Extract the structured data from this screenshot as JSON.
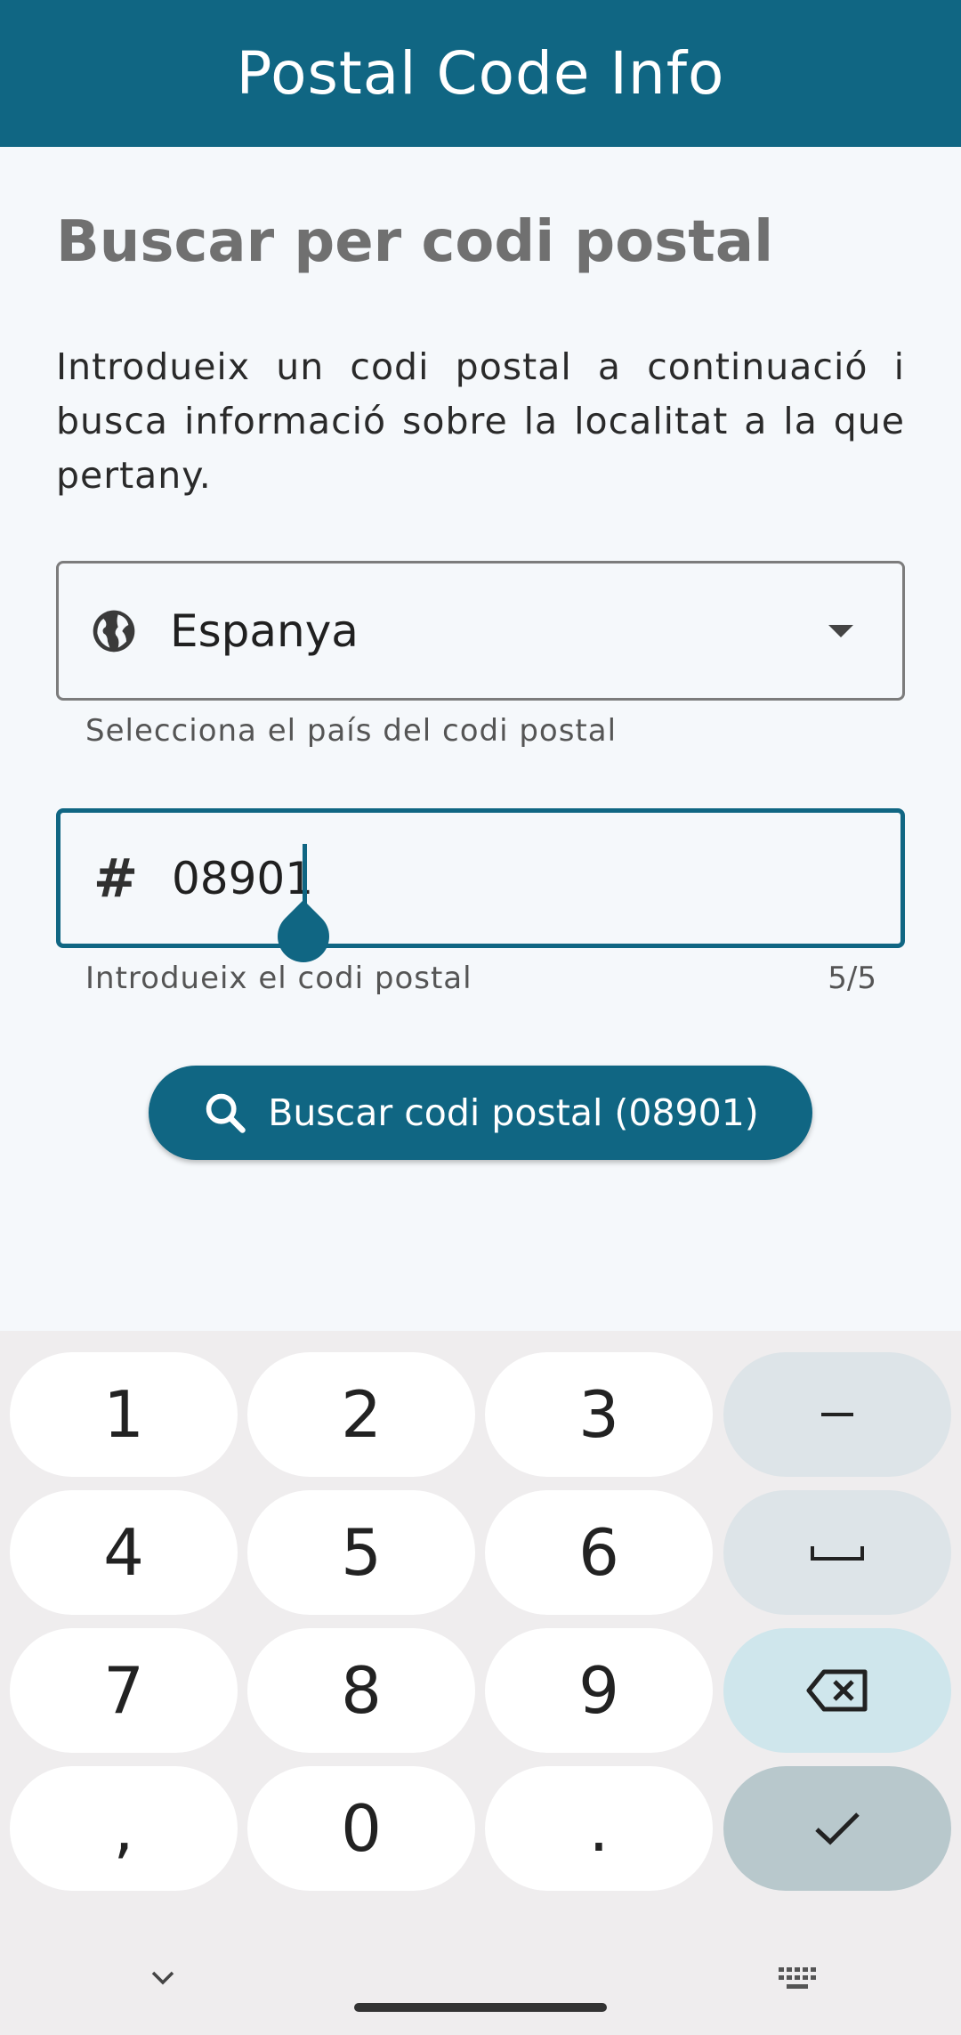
{
  "app_bar": {
    "title": "Postal Code Info"
  },
  "search": {
    "heading": "Buscar per codi postal",
    "intro": "Introdueix un codi postal a continuació i busca informació sobre la localitat a la que pertany.",
    "country_field": {
      "value": "Espanya",
      "helper": "Selecciona el país del codi postal",
      "icon": "globe-icon"
    },
    "postal_field": {
      "value": "08901",
      "helper": "Introdueix el codi postal",
      "counter": "5/5",
      "icon": "hash-icon"
    },
    "button": {
      "label": "Buscar codi postal (08901)",
      "icon": "search-icon"
    }
  },
  "colors": {
    "primary": "#106683",
    "background": "#f5f8fb",
    "keyboard_bg": "#efedee"
  },
  "keyboard": {
    "keys": [
      "1",
      "2",
      "3",
      "–",
      "4",
      "5",
      "6",
      "␣",
      "7",
      "8",
      "9",
      "⌫",
      ",",
      "0",
      ".",
      "✓"
    ]
  }
}
